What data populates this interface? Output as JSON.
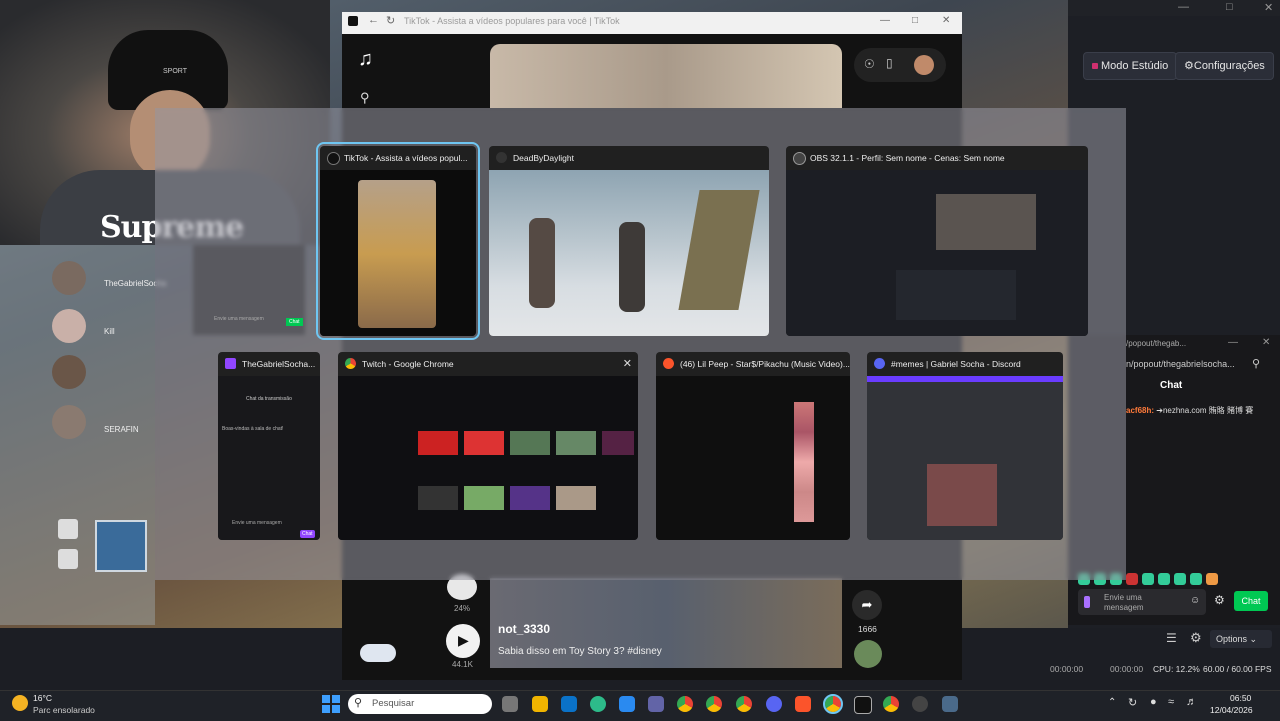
{
  "tiktok": {
    "title": "TikTok - Assista a vídeos populares para você | TikTok",
    "username": "not_3330",
    "caption": "Sabia disso em Toy Story 3? #disney",
    "like_count": "44.1K",
    "share_count": "1666",
    "percent": "24%"
  },
  "obs": {
    "studio_mode": "Modo Estúdio",
    "settings": "Configurações",
    "chat_title": "Chat",
    "chat_url": "n/popout/thegabrielsocha...",
    "chat_url_top": "/popout/thegab...",
    "chat_msg_user": "acf68h:",
    "chat_msg_text": "➔nezhna.com 賄賂 賭博 賽",
    "chat_placeholder": "Envie uma mensagem",
    "chat_button": "Chat",
    "options": "Options",
    "time1": "00:00:00",
    "time2": "00:00:00",
    "cpu": "CPU: 12.2%",
    "fps": "60.00 / 60.00 FPS"
  },
  "overlay": {
    "streamer_labels": [
      "TheGabrielSocha",
      "Kill",
      "SERAFIN"
    ]
  },
  "webcam": {
    "shirt_text": "Supreme",
    "hat_text": "SPORT"
  },
  "switcher": {
    "row1": [
      {
        "title": "TikTok - Assista a vídeos popul...",
        "icon_color": "#111111"
      },
      {
        "title": "DeadByDaylight",
        "icon_color": "#2a2a2a"
      },
      {
        "title": "OBS 32.1.1 - Perfil: Sem nome - Cenas: Sem nome",
        "icon_color": "#555555"
      }
    ],
    "row2": [
      {
        "title": "TheGabrielSocha...",
        "icon_color": "#9146ff"
      },
      {
        "title": "Twitch - Google Chrome",
        "icon_color": "#4caf50"
      },
      {
        "title": "(46) Lil Peep - Star$/Pikachu (Music Video)...",
        "icon_color": "#fb542b"
      },
      {
        "title": "#memes | Gabriel Socha - Discord",
        "icon_color": "#5865f2"
      }
    ],
    "twitch_chat_title": "Chat da transmissão",
    "twitch_chat_welcome": "Boas-vindas à sala de chat!",
    "twitch_chat_placeholder": "Envie uma mensagem",
    "twitch_chat_btn": "Chat",
    "small_chat_placeholder": "Envie uma mensagem",
    "small_chat_btn": "Chat"
  },
  "taskbar": {
    "weather_temp": "16°C",
    "weather_desc": "Parc ensolarado",
    "search_placeholder": "Pesquisar",
    "time": "06:50",
    "date": "12/04/2026"
  },
  "colors": {
    "accent": "#6fc6f2",
    "twitch": "#9146ff",
    "chat_green": "#00c853"
  }
}
